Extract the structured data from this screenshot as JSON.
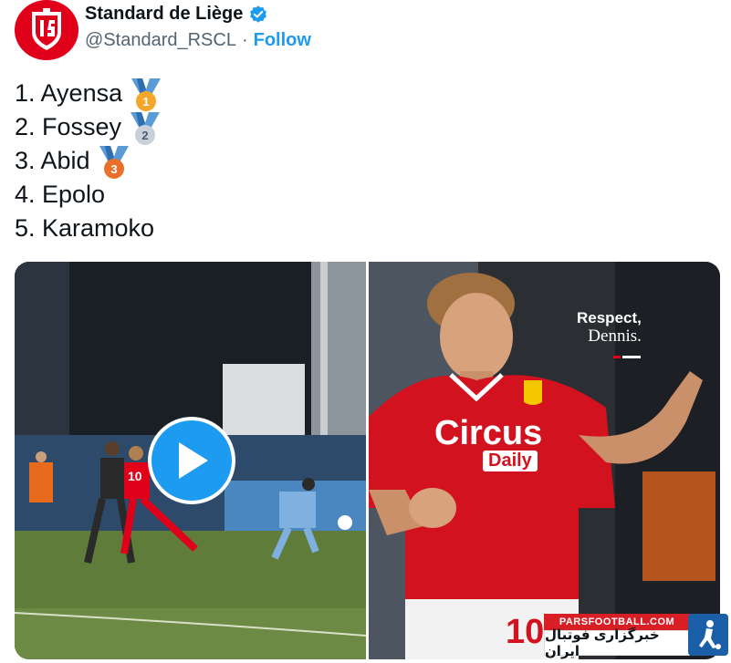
{
  "tweet": {
    "author_name": "Standard de Liège",
    "handle": "@Standard_RSCL",
    "separator": "·",
    "follow_label": "Follow"
  },
  "ranking": [
    {
      "text": "1. Ayensa",
      "medal": "gold-medal-icon",
      "medal_number": "1"
    },
    {
      "text": "2. Fossey",
      "medal": "silver-medal-icon",
      "medal_number": "2"
    },
    {
      "text": "3. Abid",
      "medal": "bronze-medal-icon",
      "medal_number": "3"
    },
    {
      "text": "4. Epolo"
    },
    {
      "text": "5. Karamoko"
    }
  ],
  "media": {
    "video": {
      "play_icon": "play-icon",
      "jersey_number": "10"
    },
    "photo": {
      "overlay_title": "Respect,",
      "overlay_subtitle": "Dennis.",
      "sponsor_line1": "Circus",
      "sponsor_line2": "Daily",
      "jersey_number": "10"
    }
  },
  "watermark": {
    "site": "PARSFOOTBALL.COM",
    "persian_text": "خبرگزاری فوتبال ایران"
  },
  "colors": {
    "brand_red": "#e0001a",
    "follow_blue": "#1d9bf0",
    "verified_blue": "#1d9bf0",
    "text": "#0f1419",
    "muted": "#536471"
  }
}
